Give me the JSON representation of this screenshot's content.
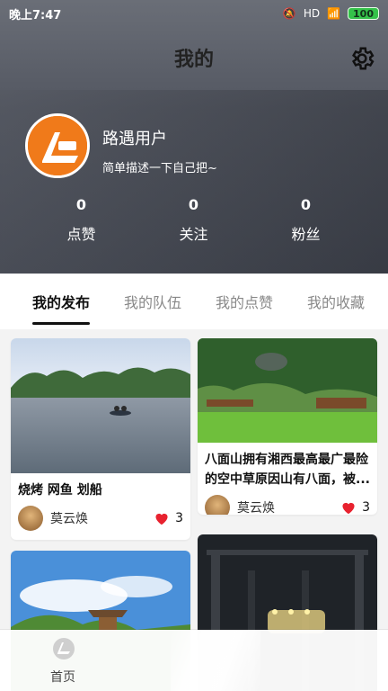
{
  "status_bar": {
    "time": "晚上7:47",
    "network": "HD",
    "battery": "100"
  },
  "header": {
    "title": "我的"
  },
  "profile": {
    "username": "路遇用户",
    "bio": "简单描述一下自己把~",
    "stats": [
      {
        "value": "0",
        "label": "点赞"
      },
      {
        "value": "0",
        "label": "关注"
      },
      {
        "value": "0",
        "label": "粉丝"
      }
    ]
  },
  "tabs": [
    {
      "label": "我的发布",
      "active": true
    },
    {
      "label": "我的队伍",
      "active": false
    },
    {
      "label": "我的点赞",
      "active": false
    },
    {
      "label": "我的收藏",
      "active": false
    }
  ],
  "cards": [
    {
      "title": "烧烤  网鱼 划船",
      "author": "莫云焕",
      "likes": "3"
    },
    {
      "title": "八面山拥有湘西最高最广最险的空中草原因山有八面，被...",
      "author": "莫云焕",
      "likes": "3"
    },
    {
      "title": "",
      "author": "",
      "likes": ""
    },
    {
      "title": "",
      "author": "",
      "likes": ""
    }
  ],
  "bottom_nav": {
    "items": [
      {
        "label": "首页",
        "icon": "app-logo-icon"
      }
    ]
  },
  "colors": {
    "accent_orange": "#f07a1a",
    "heart_red": "#e8222f"
  }
}
